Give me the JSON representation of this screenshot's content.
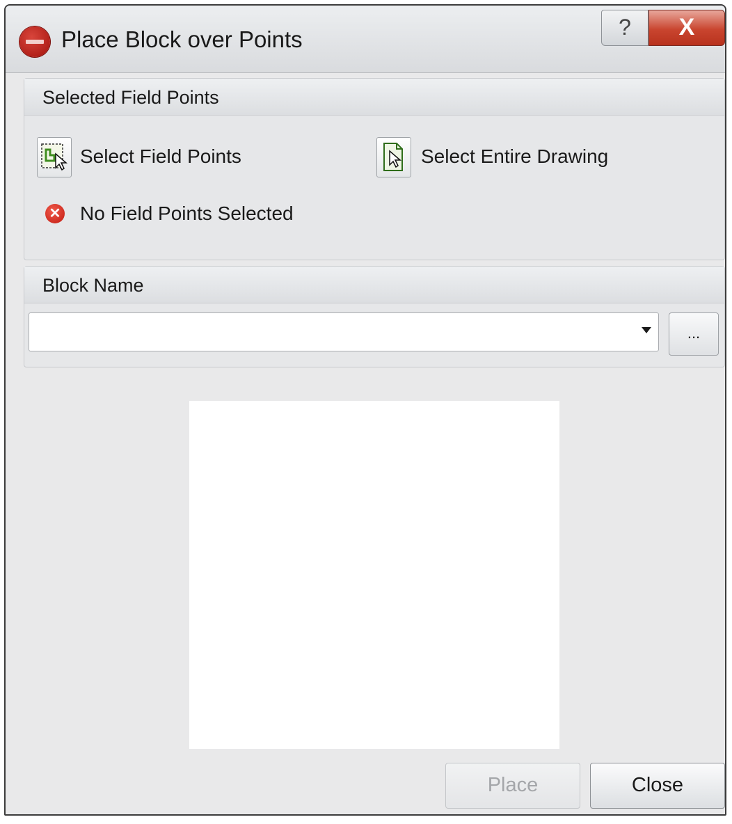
{
  "window": {
    "title": "Place Block over Points",
    "help_glyph": "?",
    "close_glyph": "X",
    "app_icon": "red-circle-logo-icon"
  },
  "selected_field_points": {
    "header": "Selected Field Points",
    "select_field_points_label": "Select Field Points",
    "select_field_points_icon": "select-points-icon",
    "select_entire_drawing_label": "Select Entire Drawing",
    "select_entire_drawing_icon": "select-drawing-icon",
    "status_icon": "error-icon",
    "status_glyph": "✕",
    "status_text": "No Field Points Selected"
  },
  "block_name": {
    "header": "Block Name",
    "value": "",
    "browse_label": "..."
  },
  "actions": {
    "place_label": "Place",
    "place_enabled": false,
    "close_label": "Close"
  },
  "colors": {
    "error_red": "#c21a10",
    "close_red": "#c9452f",
    "disabled_text": "#a4a6a9"
  }
}
